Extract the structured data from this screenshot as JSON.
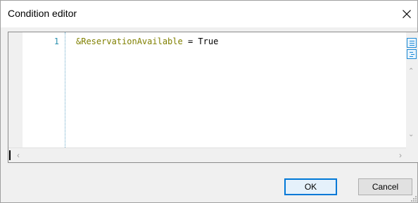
{
  "window": {
    "title": "Condition editor",
    "close_icon": "close-icon"
  },
  "editor": {
    "line_number": "1",
    "code_variable": "&ReservationAvailable",
    "code_operator": " = ",
    "code_value": "True",
    "colors": {
      "variable": "#808000",
      "line_number": "#2b91af"
    }
  },
  "buttons": {
    "ok_label": "OK",
    "cancel_label": "Cancel"
  }
}
